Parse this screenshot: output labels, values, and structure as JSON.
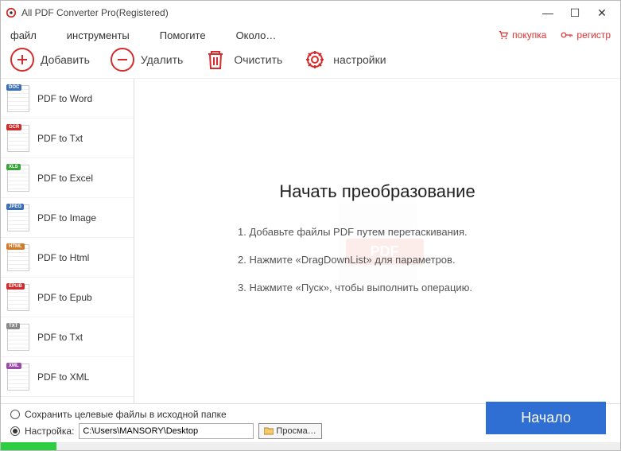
{
  "titlebar": {
    "title": "All PDF Converter Pro(Registered)"
  },
  "menu": {
    "items": [
      "файл",
      "инструменты",
      "Помогите",
      "Около…"
    ],
    "buy": "покупка",
    "register": "регистр"
  },
  "toolbar": {
    "add": "Добавить",
    "delete": "Удалить",
    "clear": "Очистить",
    "settings": "настройки"
  },
  "sidebar": {
    "items": [
      {
        "label": "PDF to Word",
        "badge": "DOC",
        "color": "#3b6fb5"
      },
      {
        "label": "PDF to Txt",
        "badge": "OCR",
        "color": "#d02a2a"
      },
      {
        "label": "PDF to Excel",
        "badge": "XLS",
        "color": "#3aa23a"
      },
      {
        "label": "PDF to Image",
        "badge": "JPEG",
        "color": "#3b6fb5"
      },
      {
        "label": "PDF to Html",
        "badge": "HTML",
        "color": "#d07a2a"
      },
      {
        "label": "PDF to Epub",
        "badge": "EPUB",
        "color": "#d02a2a"
      },
      {
        "label": "PDF to Txt",
        "badge": "TXT",
        "color": "#888"
      },
      {
        "label": "PDF to XML",
        "badge": "XML",
        "color": "#9a4ba8"
      }
    ]
  },
  "main": {
    "heading": "Начать преобразование",
    "step1": "1. Добавьте файлы PDF путем перетаскивания.",
    "step2": "2. Нажмите «DragDownList» для параметров.",
    "step3": "3. Нажмите «Пуск», чтобы выполнить операцию.",
    "watermark": "PDF"
  },
  "footer": {
    "save_source": "Сохранить целевые файлы в исходной папке",
    "custom_label": "Настройка:",
    "path": "C:\\Users\\MANSORY\\Desktop",
    "browse": "Просма…",
    "start": "Начало"
  }
}
